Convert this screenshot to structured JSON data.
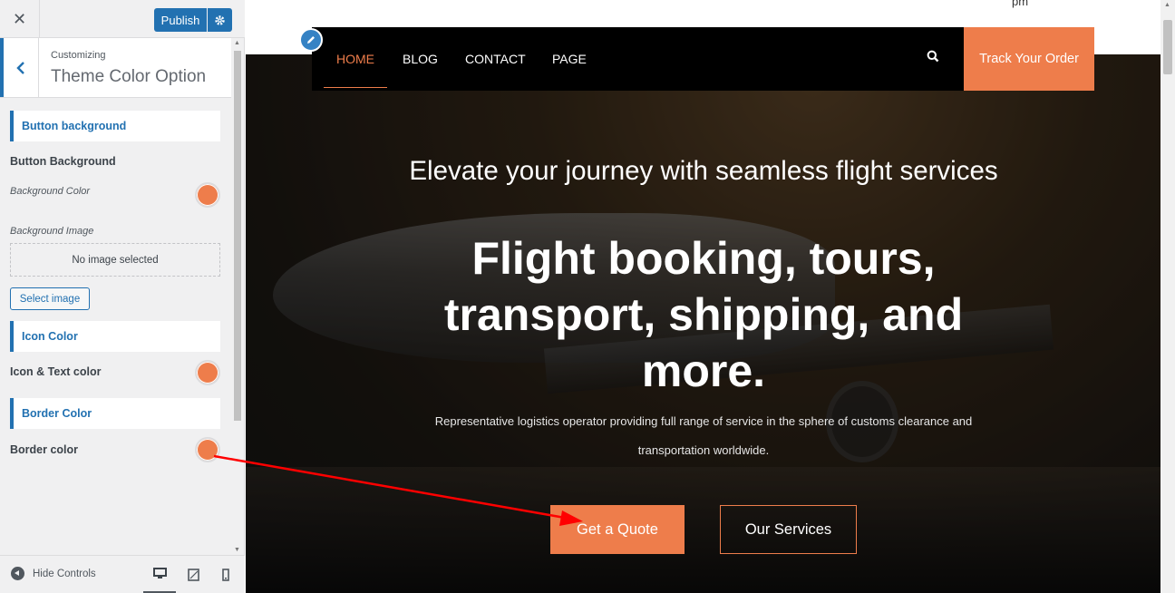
{
  "panel": {
    "close_glyph": "✕",
    "publish_label": "Publish",
    "customizing_label": "Customizing",
    "section_title": "Theme Color Option",
    "button_group_title": "Button background",
    "button_bg_label": "Button Background",
    "bg_color_label": "Background Color",
    "bg_image_label": "Background Image",
    "no_image_text": "No image selected",
    "select_image_label": "Select image",
    "icon_group_title": "Icon Color",
    "icon_text_label": "Icon & Text color",
    "border_group_title": "Border Color",
    "border_color_label": "Border color",
    "hide_controls_label": "Hide Controls",
    "swatch_color": "#ee7d4b",
    "accent_color": "#2271b1"
  },
  "preview": {
    "top_text": "pm",
    "nav": {
      "home": "HOME",
      "blog": "BLOG",
      "contact": "CONTACT",
      "page": "PAGE",
      "track_order": "Track Your Order"
    },
    "hero_subtitle": "Elevate your journey with seamless flight services",
    "hero_title": "Flight booking, tours, transport, shipping, and more.",
    "hero_description": "Representative logistics operator providing full range of service in the sphere of customs clearance and transportation worldwide.",
    "quote_button": "Get a Quote",
    "services_button": "Our Services",
    "accent_color": "#ee7d4b"
  },
  "annotation": {
    "arrow_color": "#ff0000"
  }
}
